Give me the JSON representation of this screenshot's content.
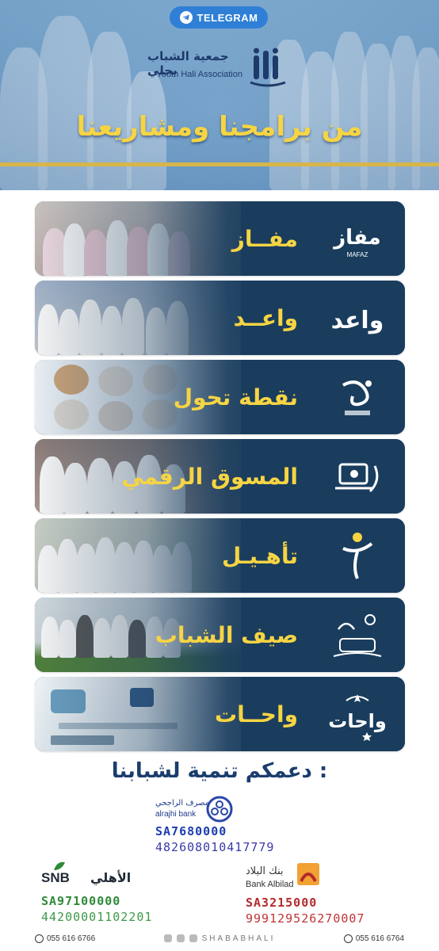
{
  "header": {
    "telegram_label": "TELEGRAM",
    "logo_ar": "جمعية الشباب بحلي",
    "logo_en": "Youth Hali Association",
    "title": "من برامجنا ومشاريعنا"
  },
  "programs": [
    {
      "name": "مفــاز",
      "emblem": "mafaz-emblem"
    },
    {
      "name": "واعــد",
      "emblem": "waed-emblem"
    },
    {
      "name": "نقطة تحول",
      "emblem": "turning-point-emblem"
    },
    {
      "name": "المسوق الرقمي",
      "emblem": "digital-marketer-emblem"
    },
    {
      "name": "تأهـيـل",
      "emblem": "taheel-emblem"
    },
    {
      "name": "صيف الشباب",
      "emblem": "youth-summer-emblem"
    },
    {
      "name": "واحــات",
      "emblem": "wahat-emblem"
    }
  ],
  "support": {
    "title": "دعمكم تنمية لشبابنا :"
  },
  "banks": {
    "rajhi": {
      "name_ar": "مصرف الراجحي",
      "name_en": "alrajhi bank",
      "iban_1": "SA7680000",
      "iban_2": "482608010417779"
    },
    "snb": {
      "name_en": "SNB",
      "name_ar": "الأهلي",
      "iban_1": "SA97100000",
      "iban_2": "44200001102201"
    },
    "albilad": {
      "name_ar": "بنك البلاد",
      "name_en": "Bank Albilad",
      "iban_1": "SA3215000",
      "iban_2": "999129526270007"
    }
  },
  "footer": {
    "phone_left": "055 616 6766",
    "handle": "SHABABHALI",
    "phone_right": "055 616 6764"
  },
  "colors": {
    "gold": "#f6d443",
    "navy": "#1a3d5e",
    "telegram": "#2f7fd6"
  }
}
